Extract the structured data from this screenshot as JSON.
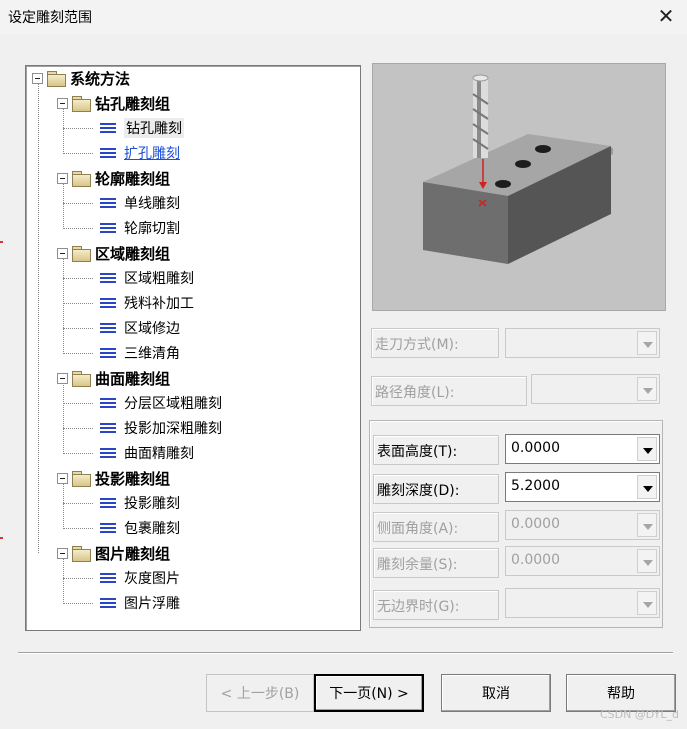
{
  "window": {
    "title": "设定雕刻范围",
    "close_symbol": "✕"
  },
  "tree": {
    "root": "系统方法",
    "groups": [
      {
        "label": "钻孔雕刻组",
        "items": [
          "钻孔雕刻",
          "扩孔雕刻"
        ]
      },
      {
        "label": "轮廓雕刻组",
        "items": [
          "单线雕刻",
          "轮廓切割"
        ]
      },
      {
        "label": "区域雕刻组",
        "items": [
          "区域粗雕刻",
          "残料补加工",
          "区域修边",
          "三维清角"
        ]
      },
      {
        "label": "曲面雕刻组",
        "items": [
          "分层区域粗雕刻",
          "投影加深粗雕刻",
          "曲面精雕刻"
        ]
      },
      {
        "label": "投影雕刻组",
        "items": [
          "投影雕刻",
          "包裹雕刻"
        ]
      },
      {
        "label": "图片雕刻组",
        "items": [
          "灰度图片",
          "图片浮雕"
        ]
      }
    ]
  },
  "fields": {
    "feed_mode_label": "走刀方式(M):",
    "path_angle_label": "路径角度(L):",
    "surface_height_label": "表面高度(T):",
    "surface_height_value": "0.0000",
    "carve_depth_label": "雕刻深度(D):",
    "carve_depth_value": "5.2000",
    "side_angle_label": "侧面角度(A):",
    "side_angle_value": "0.0000",
    "carve_allowance_label": "雕刻余量(S):",
    "carve_allowance_value": "0.0000",
    "no_border_label": "无边界时(G):"
  },
  "buttons": {
    "prev": "< 上一步(B)",
    "next": "下一页(N) >",
    "cancel": "取消",
    "help": "帮助"
  },
  "watermark": "CSDN @DYL_d",
  "colors": {
    "list_icon": "#2b45c8",
    "link": "#1a4fd6",
    "marker": "#d32020"
  }
}
